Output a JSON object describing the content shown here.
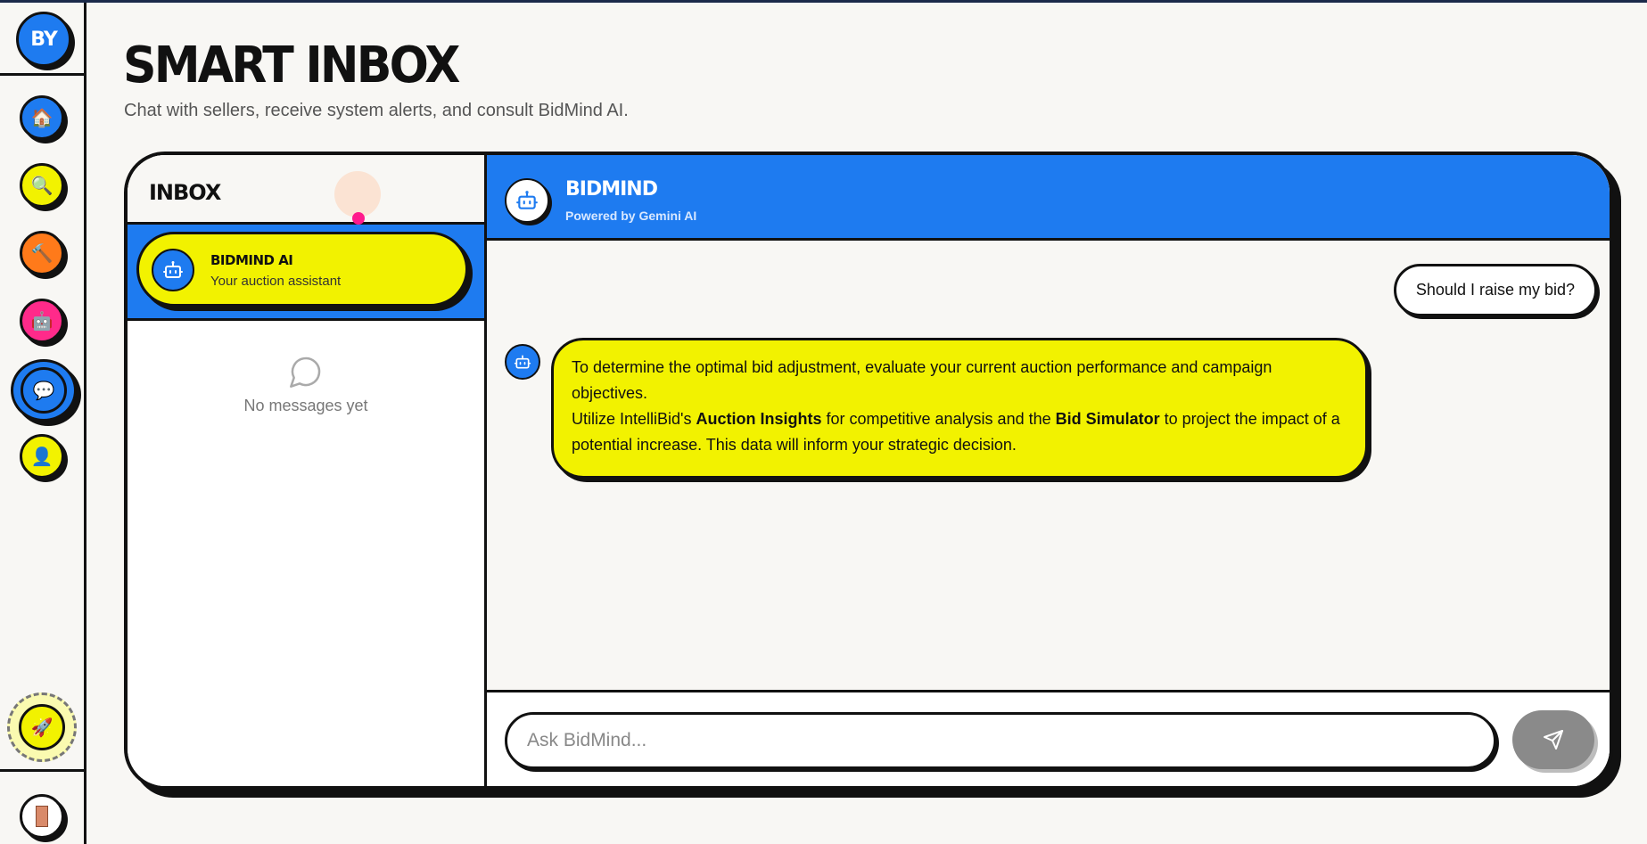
{
  "sidebar": {
    "logo_text": "BY",
    "items": [
      {
        "icon": "home-icon",
        "glyph": "🏠",
        "color": "#1e7bf0"
      },
      {
        "icon": "search-icon",
        "glyph": "🔍",
        "color": "#f2f200"
      },
      {
        "icon": "hammer-icon",
        "glyph": "🔨",
        "color": "#ff7a1a"
      },
      {
        "icon": "robot-icon",
        "glyph": "🤖",
        "color": "#ff2a8a"
      },
      {
        "icon": "chat-bubble-icon",
        "glyph": "💬",
        "color": "#1e7bf0",
        "active": true
      },
      {
        "icon": "user-icon",
        "glyph": "👤",
        "color": "#f2f200"
      }
    ],
    "rocket_glyph": "🚀",
    "logout_icon": "door-icon"
  },
  "header": {
    "title": "SMART INBOX",
    "subtitle": "Chat with sellers, receive system alerts, and consult BidMind AI."
  },
  "inbox": {
    "title": "INBOX",
    "conversations": [
      {
        "name": "BIDMIND AI",
        "subtitle": "Your auction assistant",
        "icon": "robot-icon",
        "selected": true
      }
    ],
    "empty_text": "No messages yet"
  },
  "chat": {
    "title": "BIDMIND",
    "subtitle": "Powered by Gemini AI",
    "messages": [
      {
        "from": "user",
        "text": "Should I raise my bid?"
      },
      {
        "from": "bot",
        "line1": "To determine the optimal bid adjustment, evaluate your current auction performance and campaign objectives.",
        "line2_pre": "Utilize IntelliBid's ",
        "line2_bold1": "Auction Insights",
        "line2_mid": " for competitive analysis and the ",
        "line2_bold2": "Bid Simulator",
        "line2_post": " to project the impact of a potential increase. This data will inform your strategic decision."
      }
    ],
    "composer_placeholder": "Ask BidMind..."
  },
  "colors": {
    "accent_blue": "#1e7bf0",
    "accent_yellow": "#f2f200",
    "accent_pink": "#ff2a8a",
    "accent_orange": "#ff7a1a",
    "send_disabled": "#8a8a8a"
  }
}
